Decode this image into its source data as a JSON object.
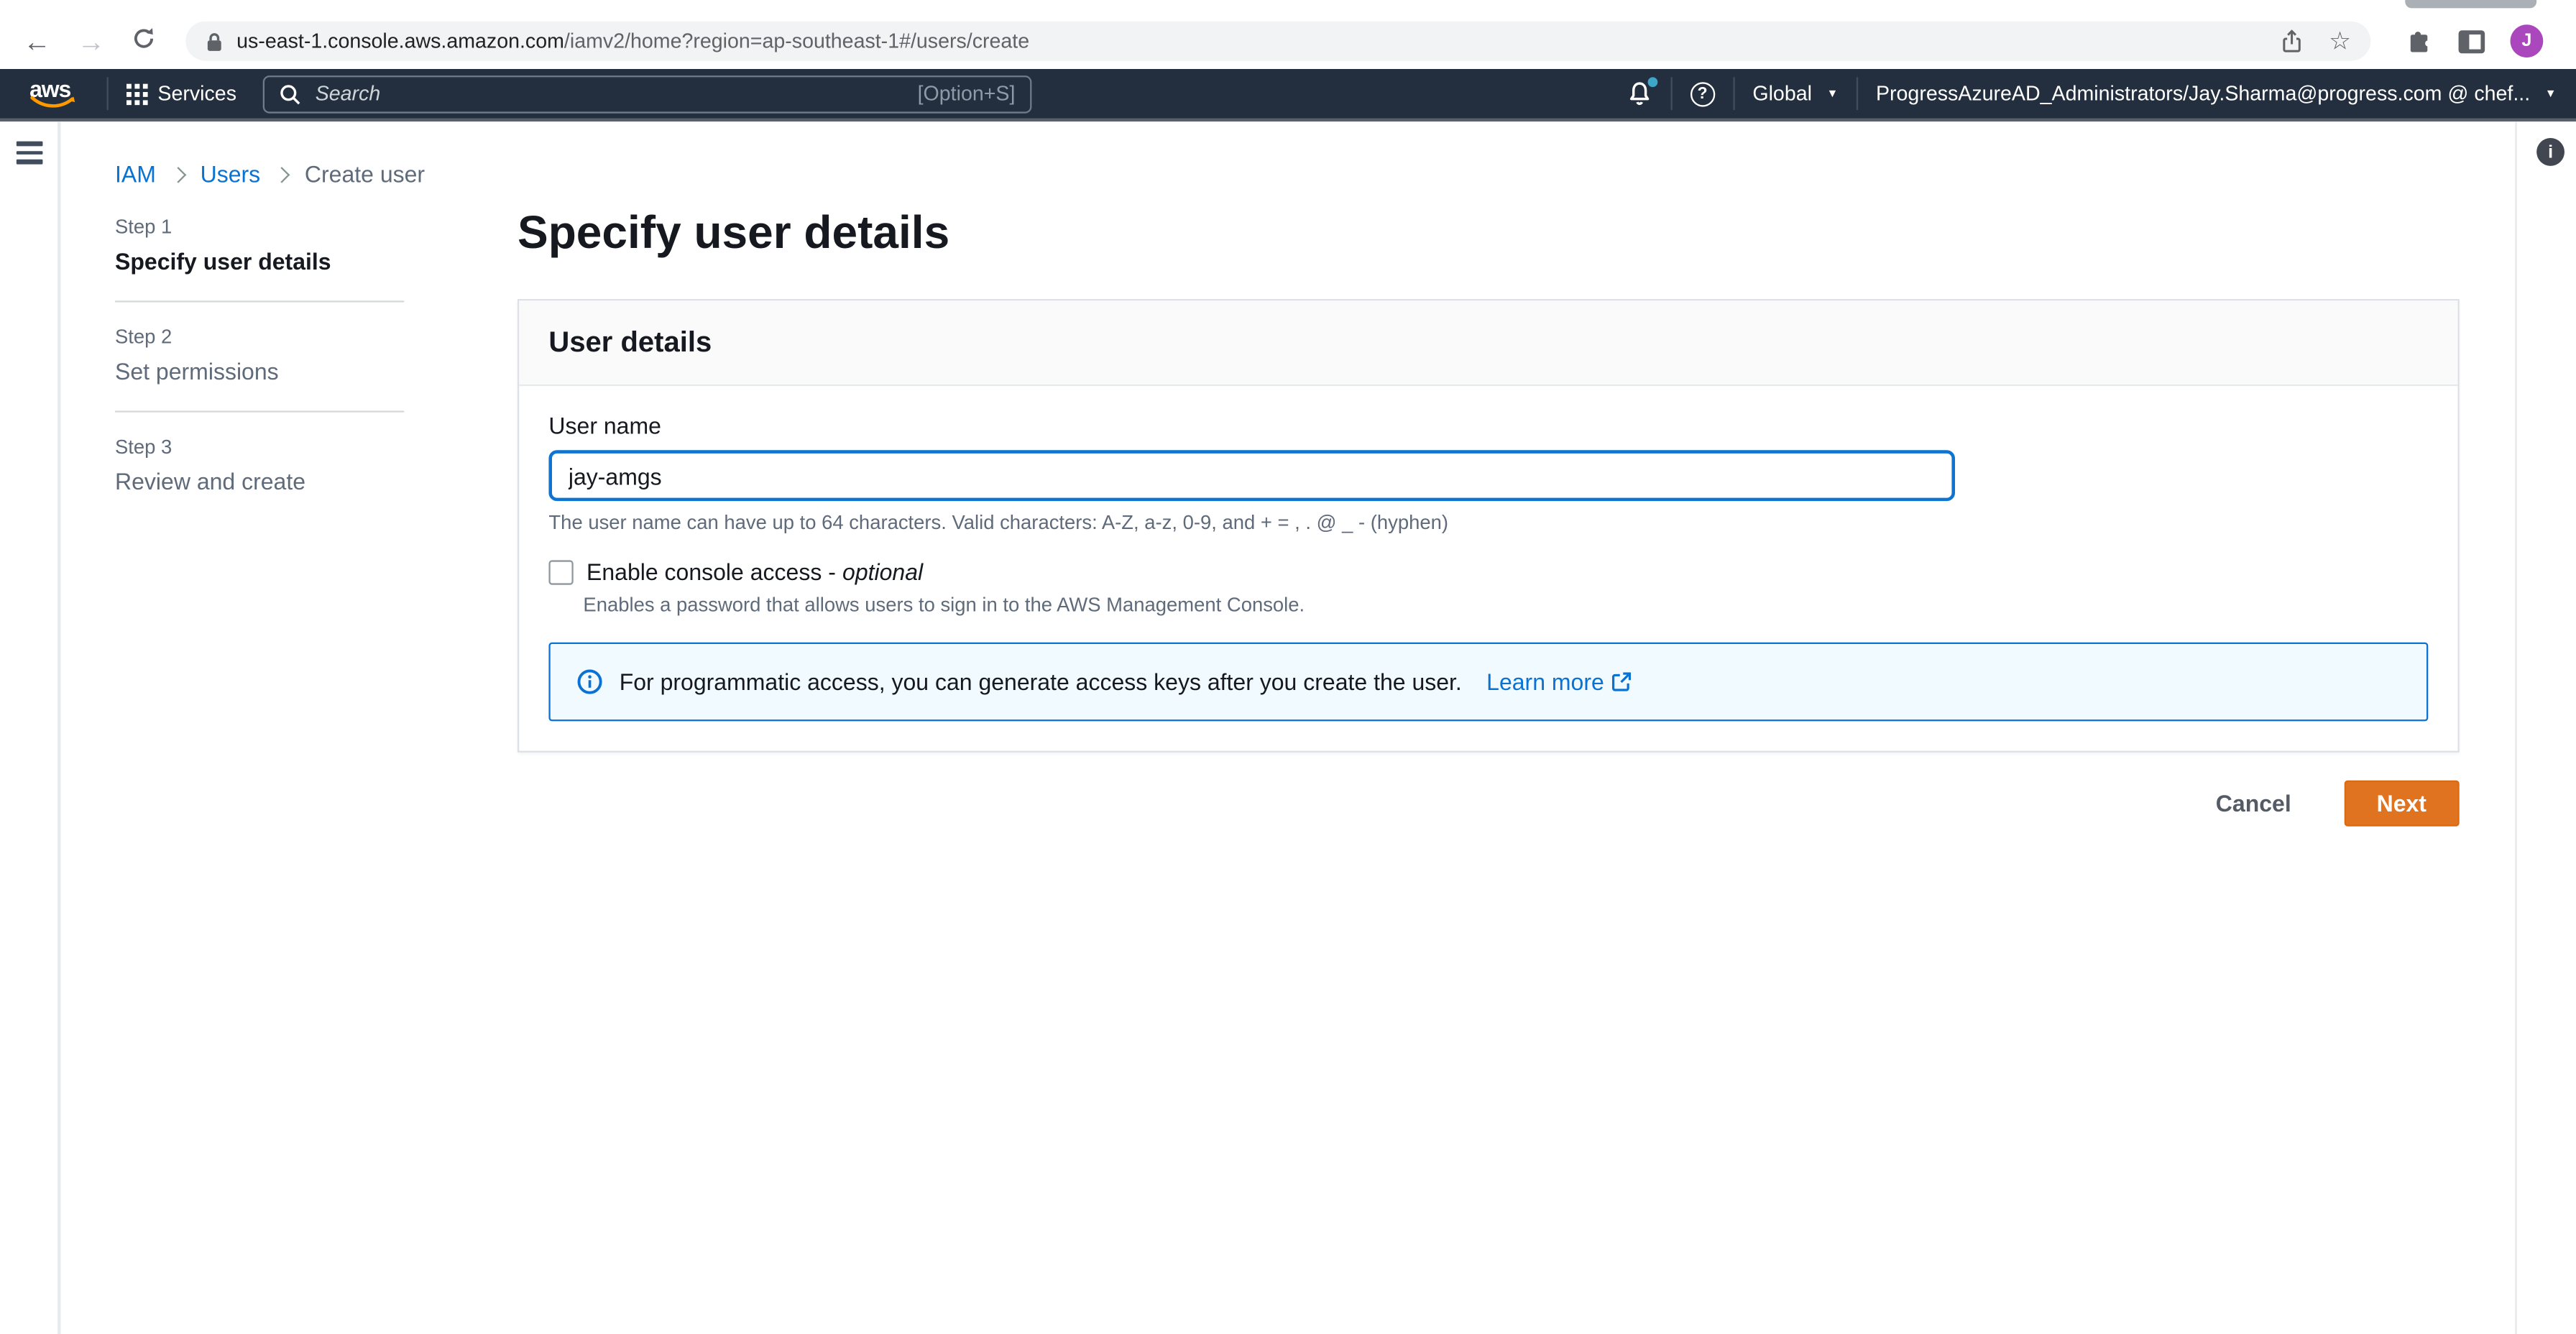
{
  "browser": {
    "url_host": "us-east-1.console.aws.amazon.com",
    "url_path": "/iamv2/home?region=ap-southeast-1#/users/create",
    "avatar_letter": "J"
  },
  "top_nav": {
    "logo_text": "aws",
    "services_label": "Services",
    "search_placeholder": "Search",
    "search_shortcut": "[Option+S]",
    "region_label": "Global",
    "account_label": "ProgressAzureAD_Administrators/Jay.Sharma@progress.com @ chef..."
  },
  "breadcrumb": {
    "items": [
      "IAM",
      "Users",
      "Create user"
    ]
  },
  "steps": [
    {
      "label": "Step 1",
      "title": "Specify user details"
    },
    {
      "label": "Step 2",
      "title": "Set permissions"
    },
    {
      "label": "Step 3",
      "title": "Review and create"
    }
  ],
  "main": {
    "page_title": "Specify user details",
    "card": {
      "header": "User details",
      "username_label": "User name",
      "username_value": "jay-amgs",
      "username_hint": "The user name can have up to 64 characters. Valid characters: A-Z, a-z, 0-9, and + = , . @ _ - (hyphen)",
      "console_access_label": "Enable console access -",
      "console_access_optional": "optional",
      "console_access_hint": "Enables a password that allows users to sign in to the AWS Management Console.",
      "alert_text": "For programmatic access, you can generate access keys after you create the user.",
      "alert_link": "Learn more"
    },
    "cancel_label": "Cancel",
    "next_label": "Next"
  },
  "colors": {
    "nav_bg": "#232f3e",
    "accent_blue": "#0972d3",
    "link_blue": "#0972d3",
    "button_orange": "#e0731f",
    "alert_bg": "#f1faff",
    "badge_cyan": "#3ea6c9",
    "avatar_purple": "#ab47bc"
  }
}
